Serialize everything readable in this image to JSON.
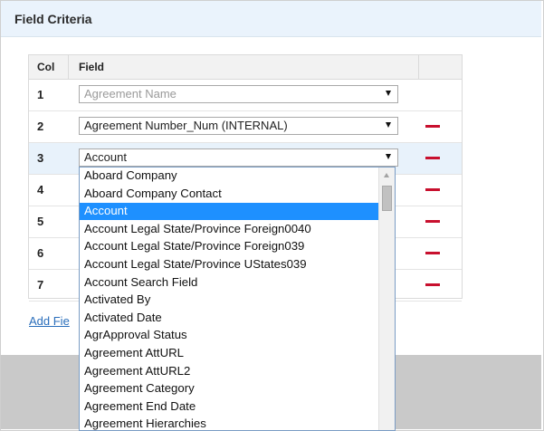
{
  "header": {
    "title": "Field Criteria"
  },
  "grid": {
    "columns": {
      "col": "Col",
      "field": "Field"
    },
    "rows": [
      {
        "num": "1",
        "value": "Agreement Name",
        "placeholder": true,
        "removable": false
      },
      {
        "num": "2",
        "value": "Agreement Number_Num (INTERNAL)",
        "placeholder": false,
        "removable": true
      },
      {
        "num": "3",
        "value": "Account",
        "placeholder": false,
        "removable": true,
        "highlighted": true
      },
      {
        "num": "4",
        "value": "",
        "removable": true
      },
      {
        "num": "5",
        "value": "",
        "removable": true
      },
      {
        "num": "6",
        "value": "",
        "removable": true
      },
      {
        "num": "7",
        "value": "",
        "removable": true
      }
    ]
  },
  "add_link": "Add Fie",
  "dropdown": {
    "selected": "Account",
    "options": [
      "Aboard Company",
      "Aboard Company Contact",
      "Account",
      "Account Legal State/Province Foreign0040",
      "Account Legal State/Province Foreign039",
      "Account Legal State/Province UStates039",
      "Account Search Field",
      "Activated By",
      "Activated Date",
      "AgrApproval Status",
      "Agreement AttURL",
      "Agreement AttURL2",
      "Agreement Category",
      "Agreement End Date",
      "Agreement Hierarchies"
    ]
  },
  "icons": {
    "remove": "minus-icon",
    "caret": "caret-down-icon"
  },
  "colors": {
    "accent": "#1e90ff",
    "remove": "#c8102e",
    "link": "#2a6ebb",
    "header_bg": "#eaf3fc"
  }
}
